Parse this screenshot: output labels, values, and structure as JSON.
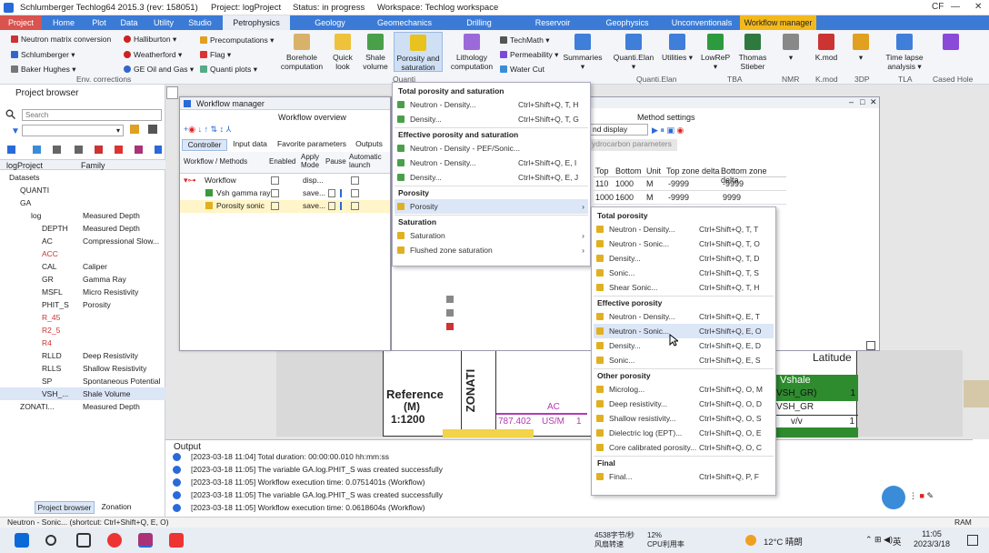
{
  "window": {
    "title": "Schlumberger Techlog64 2015.3 (rev: 158051)",
    "project": "Project: logProject",
    "status": "Status: in progress",
    "workspace": "Workspace: Techlog workspace",
    "user": "CF"
  },
  "ribbon_tabs": [
    "Project",
    "Home",
    "Plot",
    "Data",
    "Utility",
    "Studio",
    "Petrophysics",
    "Geology",
    "Geomechanics",
    "Drilling",
    "Reservoir",
    "Geophysics",
    "Unconventionals",
    "Workflow manager"
  ],
  "ribbon": {
    "env_items": [
      "Neutron matrix conversion",
      "Schlumberger",
      "Baker Hughes",
      "Halliburton",
      "Weatherford",
      "GE Oil and Gas"
    ],
    "env_label": "Env. corrections",
    "precomp": [
      "Precomputations",
      "Flag",
      "Quanti plots"
    ],
    "big1": [
      "Borehole computation",
      "Quick look",
      "Shale volume",
      "Porosity and saturation",
      "Lithology computation"
    ],
    "techmath": [
      "TechMath",
      "Permeability",
      "Water Cut"
    ],
    "summaries": "Summaries",
    "quanti": [
      "Quanti.Elan",
      "Utilities"
    ],
    "quanti_label": "Quanti.Elan",
    "tba": [
      "LowReP",
      "Thomas Stieber"
    ],
    "tba_label": "TBA",
    "nmr": "NMR",
    "kmod": "K.mod",
    "kmod_label": "K.mod",
    "tdp": "3DP",
    "tla": "Time lapse analysis",
    "tla_label": "TLA",
    "cased": "Cased Hole",
    "group_q": "Quanti"
  },
  "project_browser": {
    "title": "Project browser",
    "search_placeholder": "Search",
    "col_project": "logProject",
    "col_family": "Family",
    "tree": [
      {
        "name": "Datasets",
        "family": "",
        "indent": 0
      },
      {
        "name": "QUANTI",
        "family": "",
        "indent": 1
      },
      {
        "name": "GA",
        "family": "",
        "indent": 1
      },
      {
        "name": "log",
        "family": "Measured Depth",
        "indent": 2
      },
      {
        "name": "DEPTH",
        "family": "Measured Depth",
        "indent": 3
      },
      {
        "name": "AC",
        "family": "Compressional Slow...",
        "indent": 3
      },
      {
        "name": "ACC",
        "family": "",
        "indent": 3,
        "red": true
      },
      {
        "name": "CAL",
        "family": "Caliper",
        "indent": 3
      },
      {
        "name": "GR",
        "family": "Gamma Ray",
        "indent": 3
      },
      {
        "name": "MSFL",
        "family": "Micro Resistivity",
        "indent": 3
      },
      {
        "name": "PHIT_S",
        "family": "Porosity",
        "indent": 3
      },
      {
        "name": "R_45",
        "family": "",
        "indent": 3,
        "red": true
      },
      {
        "name": "R2_5",
        "family": "",
        "indent": 3,
        "red": true
      },
      {
        "name": "R4",
        "family": "",
        "indent": 3,
        "red": true
      },
      {
        "name": "RLLD",
        "family": "Deep Resistivity",
        "indent": 3
      },
      {
        "name": "RLLS",
        "family": "Shallow Resistivity",
        "indent": 3
      },
      {
        "name": "SP",
        "family": "Spontaneous Potential",
        "indent": 3
      },
      {
        "name": "VSH_...",
        "family": "Shale Volume",
        "indent": 3,
        "sel": true
      },
      {
        "name": "ZONATI...",
        "family": "Measured Depth",
        "indent": 1
      }
    ],
    "bottom_tabs": [
      "Project browser",
      "Zonation"
    ]
  },
  "workflow_manager": {
    "title": "Workflow manager",
    "overview": "Workflow overview",
    "tabs": [
      "Controller",
      "Input data",
      "Favorite parameters",
      "Outputs"
    ],
    "cols": [
      "Workflow / Methods",
      "Enabled",
      "Apply Mode",
      "Pause",
      "Automatic launch"
    ],
    "rows": [
      {
        "name": "Workflow",
        "apply": "disp..."
      },
      {
        "name": "Vsh gamma ray",
        "apply": "save..."
      },
      {
        "name": "Porosity sonic",
        "apply": "save..."
      }
    ]
  },
  "method_settings": {
    "title": "Method settings",
    "display_mode": "nd display",
    "hc_params": "ydrocarbon parameters",
    "cols": [
      "Top",
      "Bottom",
      "Unit",
      "Top zone delta",
      "Bottom zone delta"
    ],
    "rows": [
      [
        "110",
        "1000",
        "M",
        "-9999",
        "-9999"
      ],
      [
        "1000",
        "1600",
        "M",
        "-9999",
        "9999"
      ]
    ]
  },
  "plot": {
    "reference": "Reference",
    "ref_unit": "(M)",
    "ref_scale": "1:1200",
    "zonation": "ZONATI",
    "ac": "AC",
    "ac_min": "787.402",
    "ac_unit": "US/M",
    "ac_max": "1",
    "latitude": "Latitude",
    "vshale": "Vshale",
    "vsh_gr": "VSH_GR)",
    "vsh_gr_val": "1",
    "vsh_gr2": "VSH_GR",
    "vsh_unit": "v/v",
    "vsh_unit_val": "1"
  },
  "menu1": {
    "sections": [
      {
        "header": "Total porosity and saturation",
        "items": [
          {
            "label": "Neutron - Density...",
            "shortcut": "Ctrl+Shift+Q, T, H"
          },
          {
            "label": "Density...",
            "shortcut": "Ctrl+Shift+Q, T, G"
          }
        ]
      },
      {
        "header": "Effective porosity and saturation",
        "items": [
          {
            "label": "Neutron - Density - PEF/Sonic...",
            "shortcut": ""
          },
          {
            "label": "Neutron - Density...",
            "shortcut": "Ctrl+Shift+Q, E, I"
          },
          {
            "label": "Density...",
            "shortcut": "Ctrl+Shift+Q, E, J"
          }
        ]
      },
      {
        "header": "Porosity",
        "items": [
          {
            "label": "Porosity",
            "shortcut": "",
            "sub": true
          }
        ]
      },
      {
        "header": "Saturation",
        "items": [
          {
            "label": "Saturation",
            "shortcut": "",
            "sub": true
          },
          {
            "label": "Flushed zone saturation",
            "shortcut": "",
            "sub": true
          }
        ]
      }
    ]
  },
  "menu2": {
    "sections": [
      {
        "header": "Total porosity",
        "items": [
          {
            "label": "Neutron - Density...",
            "shortcut": "Ctrl+Shift+Q, T, T"
          },
          {
            "label": "Neutron - Sonic...",
            "shortcut": "Ctrl+Shift+Q, T, O"
          },
          {
            "label": "Density...",
            "shortcut": "Ctrl+Shift+Q, T, D"
          },
          {
            "label": "Sonic...",
            "shortcut": "Ctrl+Shift+Q, T, S"
          },
          {
            "label": "Shear Sonic...",
            "shortcut": "Ctrl+Shift+Q, T, H"
          }
        ]
      },
      {
        "header": "Effective porosity",
        "items": [
          {
            "label": "Neutron - Density...",
            "shortcut": "Ctrl+Shift+Q, E, T"
          },
          {
            "label": "Neutron - Sonic...",
            "shortcut": "Ctrl+Shift+Q, E, O"
          },
          {
            "label": "Density...",
            "shortcut": "Ctrl+Shift+Q, E, D"
          },
          {
            "label": "Sonic...",
            "shortcut": "Ctrl+Shift+Q, E, S"
          }
        ]
      },
      {
        "header": "Other porosity",
        "items": [
          {
            "label": "Microlog...",
            "shortcut": "Ctrl+Shift+Q, O, M"
          },
          {
            "label": "Deep resistivity...",
            "shortcut": "Ctrl+Shift+Q, O, D"
          },
          {
            "label": "Shallow resistivity...",
            "shortcut": "Ctrl+Shift+Q, O, S"
          },
          {
            "label": "Dielectric log (EPT)...",
            "shortcut": "Ctrl+Shift+Q, O, E"
          },
          {
            "label": "Core calibrated porosity...",
            "shortcut": "Ctrl+Shift+Q, O, C"
          }
        ]
      },
      {
        "header": "Final",
        "items": [
          {
            "label": "Final...",
            "shortcut": "Ctrl+Shift+Q, P, F"
          }
        ]
      }
    ]
  },
  "output": {
    "title": "Output",
    "lines": [
      "[2023-03-18 11:04]  Total duration: 00:00:00.010 hh:mm:ss",
      "[2023-03-18 11:05]  The variable GA.log.PHIT_S was created successfully",
      "[2023-03-18 11:05]  Workflow execution time: 0.0751401s (Workflow)",
      "[2023-03-18 11:05]  The variable GA.log.PHIT_S was created successfully",
      "[2023-03-18 11:05]  Workflow execution time: 0.0618604s (Workflow)"
    ]
  },
  "statusbar": {
    "text": "Neutron - Sonic... (shortcut: Ctrl+Shift+Q, E, O)",
    "ram": "RAM"
  },
  "taskbar": {
    "net_speed": "4538字节/秒",
    "net_label": "风扇转速",
    "cpu": "12%",
    "cpu_label": "CPU利用率",
    "weather": "12°C 晴朗",
    "lang": "英",
    "time": "11:05",
    "date": "2023/3/18"
  },
  "colors": {
    "ribbon_blue": "#3b7bd6",
    "project_red": "#d9534f",
    "workflow_yellow": "#f3b91c",
    "vshale_green": "#2e8b2e"
  }
}
